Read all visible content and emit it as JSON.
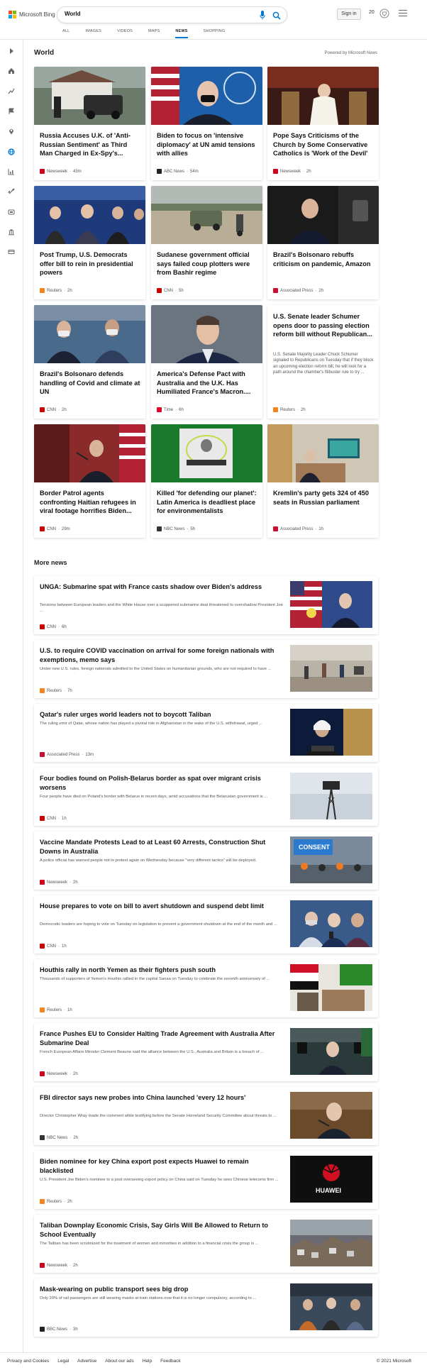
{
  "header": {
    "brand": "Microsoft Bing",
    "search_query": "World",
    "signin_label": "Sign in",
    "rewards_count": "20",
    "tabs": [
      "ALL",
      "IMAGES",
      "VIDEOS",
      "MAPS",
      "NEWS",
      "SHOPPING"
    ],
    "active_tab": "NEWS"
  },
  "section": {
    "title": "World",
    "powered_by": "Powered by Microsoft News"
  },
  "top_cards": [
    {
      "title": "Russia Accuses U.K. of 'Anti-Russian Sentiment' as Third Man Charged in Ex-Spy's...",
      "source": "Newsweek",
      "time": "43m",
      "logo_color": "#d0021b",
      "img": "house"
    },
    {
      "title": "Biden to focus on 'intensive diplomacy' at UN amid tensions with allies",
      "source": "ABC News",
      "time": "54m",
      "logo_color": "#222",
      "img": "biden"
    },
    {
      "title": "Pope Says Criticisms of the Church by Some Conservative Catholics is 'Work of the Devil'",
      "source": "Newsweek",
      "time": "2h",
      "logo_color": "#d0021b",
      "img": "pope"
    },
    {
      "title": "Post Trump, U.S. Democrats offer bill to rein in presidential powers",
      "source": "Reuters",
      "time": "2h",
      "logo_color": "#f58220",
      "img": "democrats"
    },
    {
      "title": "Sudanese government official says failed coup plotters were from Bashir regime",
      "source": "CNN",
      "time": "5h",
      "logo_color": "#cc0000",
      "img": "sudan"
    },
    {
      "title": "Brazil's Bolsonaro rebuffs criticism on pandemic, Amazon",
      "source": "Associated Press",
      "time": "2h",
      "logo_color": "#c8102e",
      "img": "bolsonaro"
    },
    {
      "title": "Brazil's Bolsonaro defends handling of Covid and climate at UN",
      "source": "CNN",
      "time": "2h",
      "logo_color": "#cc0000",
      "img": "bolsonaro2"
    },
    {
      "title": "America's Defense Pact with Australia and the U.K. Has Humiliated France's Macron....",
      "source": "Time",
      "time": "6h",
      "logo_color": "#e4002b",
      "img": "macron"
    },
    {
      "title": "U.S. Senate leader Schumer opens door to passing election reform bill without Republican...",
      "desc": "U.S. Senate Majority Leader Chuck Schumer signaled to Republicans on Tuesday that if they block an upcoming election reform bill, he will look for a path around the chamber's filibuster rule to try ...",
      "source": "Reuters",
      "time": "2h",
      "logo_color": "#f58220",
      "img": ""
    },
    {
      "title": "Border Patrol agents confronting Haitian refugees in viral footage horrifies Biden...",
      "source": "CNN",
      "time": "29m",
      "logo_color": "#cc0000",
      "img": "mayorkas"
    },
    {
      "title": "Killed 'for defending our planet': Latin America is deadliest place for environmentalists",
      "source": "NBC News",
      "time": "5h",
      "logo_color": "#333",
      "img": "green"
    },
    {
      "title": "Kremlin's party gets 324 of 450 seats in Russian parliament",
      "source": "Associated Press",
      "time": "1h",
      "logo_color": "#c8102e",
      "img": "kremlin"
    }
  ],
  "more_news_title": "More news",
  "more_news": [
    {
      "title": "UNGA: Submarine spat with France casts shadow over Biden's address",
      "desc": "Tensions between European leaders and the White House over a scuppered submarine deal threatened to overshadow President Joe ...",
      "source": "CNN",
      "time": "6h",
      "logo_color": "#cc0000",
      "img": "unga"
    },
    {
      "title": "U.S. to require COVID vaccination on arrival for some foreign nationals with exemptions, memo says",
      "desc": "Under new U.S. rules, foreign nationals admitted to the United States on humanitarian grounds, who are not required to have ...",
      "source": "Reuters",
      "time": "7h",
      "logo_color": "#f58220",
      "img": "airport"
    },
    {
      "title": "Qatar's ruler urges world leaders not to boycott Taliban",
      "desc": "The ruling emir of Qatar, whose nation has played a pivotal role in Afghanistan in the wake of the U.S. withdrawal, urged ...",
      "source": "Associated Press",
      "time": "13m",
      "logo_color": "#c8102e",
      "img": "qatar"
    },
    {
      "title": "Four bodies found on Polish-Belarus border as spat over migrant crisis worsens",
      "desc": "Four people have died on Poland's border with Belarus in recent days, amid accusations that the Belarusian government is ...",
      "source": "CNN",
      "time": "1h",
      "logo_color": "#cc0000",
      "img": "tower"
    },
    {
      "title": "Vaccine Mandate Protests Lead to at Least 60 Arrests, Construction Shut Downs in Australia",
      "desc": "A police official has warned people not to protest again on Wednesday because \"very different tactics\" will be deployed.",
      "source": "Newsweek",
      "time": "2h",
      "logo_color": "#d0021b",
      "img": "protest"
    },
    {
      "title": "House prepares to vote on bill to avert shutdown and suspend debt limit",
      "desc": "Democratic leaders are hoping to vote on Tuesday on legislation to prevent a government shutdown at the end of the month and ...",
      "source": "CNN",
      "time": "1h",
      "logo_color": "#cc0000",
      "img": "pelosi"
    },
    {
      "title": "Houthis rally in north Yemen as their fighters push south",
      "desc": "Thousands of supporters of Yemen's Houthis rallied in the capital Sanaa on Tuesday to celebrate the seventh anniversary of ...",
      "source": "Reuters",
      "time": "1h",
      "logo_color": "#f58220",
      "img": "yemen"
    },
    {
      "title": "France Pushes EU to Consider Halting Trade Agreement with Australia After Submarine Deal",
      "desc": "French European Affairs Minister Clement Beaune said the alliance between the U.S., Australia and Britain is a breach of ...",
      "source": "Newsweek",
      "time": "2h",
      "logo_color": "#d0021b",
      "img": "beaune"
    },
    {
      "title": "FBI director says new probes into China launched 'every 12 hours'",
      "desc": "Director Christopher Wray made the comment while testifying before the Senate Homeland Security Committee about threats to ...",
      "source": "NBC News",
      "time": "2h",
      "logo_color": "#333",
      "img": "wray"
    },
    {
      "title": "Biden nominee for key China export post expects Huawei to remain blacklisted",
      "desc": "U.S. President Joe Biden's nominee to a post overseeing export policy on China said on Tuesday he sees Chinese telecoms firm ...",
      "source": "Reuters",
      "time": "2h",
      "logo_color": "#f58220",
      "img": "huawei"
    },
    {
      "title": "Taliban Downplay Economic Crisis, Say Girls Will Be Allowed to Return to School Eventually",
      "desc": "The Taliban has been scrutinized for the treatment of women and minorities in addition to a financial crisis the group is ...",
      "source": "Newsweek",
      "time": "2h",
      "logo_color": "#d0021b",
      "img": "kabul"
    },
    {
      "title": "Mask-wearing on public transport sees big drop",
      "desc": "Only 20% of rail passengers are still wearing masks at train stations now that it is no longer compulsory, according to ...",
      "source": "BBC News",
      "time": "3h",
      "logo_color": "#222",
      "img": "train"
    }
  ],
  "footer": {
    "links": [
      "Privacy and Cookies",
      "Legal",
      "Advertise",
      "About our ads",
      "Help",
      "Feedback"
    ],
    "copyright": "© 2021 Microsoft"
  },
  "colors": {
    "accent": "#0078d4",
    "bing_red": "#f25022",
    "bing_green": "#7fba00",
    "bing_blue": "#00a4ef",
    "bing_yellow": "#ffb900"
  }
}
